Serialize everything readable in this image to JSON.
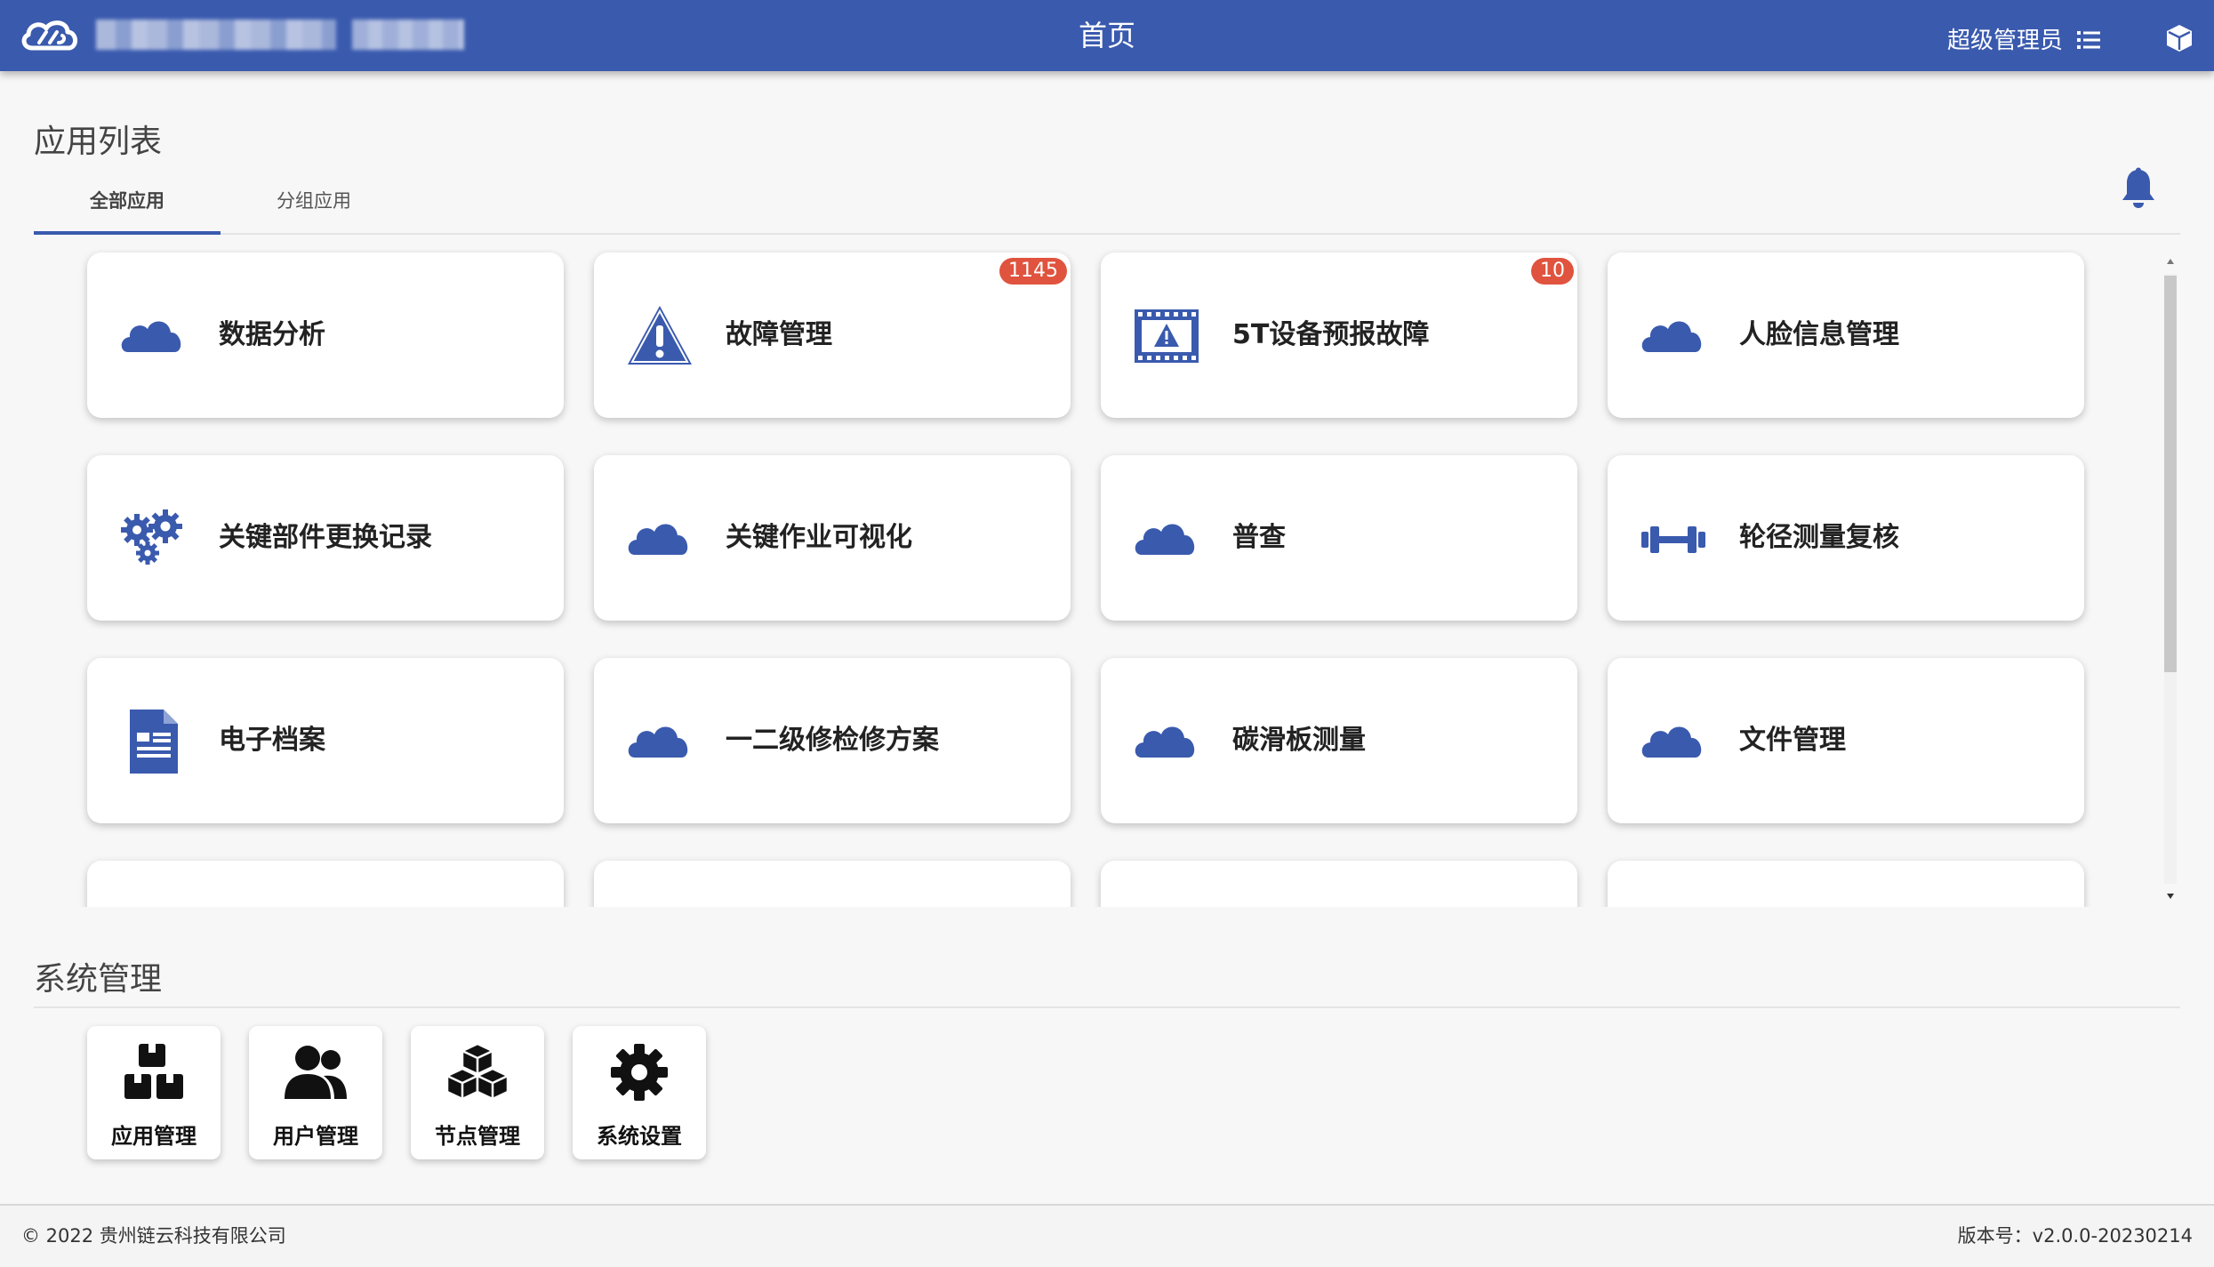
{
  "header": {
    "title": "首页",
    "user": "超级管理员",
    "brand_color": "#3a5aae",
    "logo_icon": "cloud-link-logo",
    "menu_icon": "list-icon",
    "box_icon": "cube-icon"
  },
  "apps": {
    "title": "应用列表",
    "tabs": [
      {
        "label": "全部应用",
        "active": true
      },
      {
        "label": "分组应用",
        "active": false
      }
    ],
    "bell_icon": "bell-icon",
    "items": [
      {
        "label": "数据分析",
        "icon": "cloud-icon",
        "badge": ""
      },
      {
        "label": "故障管理",
        "icon": "warning-triangle-icon",
        "badge": "1145"
      },
      {
        "label": "5T设备预报故障",
        "icon": "film-warning-icon",
        "badge": "10"
      },
      {
        "label": "人脸信息管理",
        "icon": "cloud-icon",
        "badge": ""
      },
      {
        "label": "关键部件更换记录",
        "icon": "gears-icon",
        "badge": ""
      },
      {
        "label": "关键作业可视化",
        "icon": "cloud-icon",
        "badge": ""
      },
      {
        "label": "普查",
        "icon": "cloud-icon",
        "badge": ""
      },
      {
        "label": "轮径测量复核",
        "icon": "dumbbell-icon",
        "badge": ""
      },
      {
        "label": "电子档案",
        "icon": "document-icon",
        "badge": ""
      },
      {
        "label": "一二级修检修方案",
        "icon": "cloud-icon",
        "badge": ""
      },
      {
        "label": "碳滑板测量",
        "icon": "cloud-icon",
        "badge": ""
      },
      {
        "label": "文件管理",
        "icon": "cloud-icon",
        "badge": ""
      }
    ]
  },
  "system": {
    "title": "系统管理",
    "items": [
      {
        "label": "应用管理",
        "icon": "boxes-icon"
      },
      {
        "label": "用户管理",
        "icon": "users-icon"
      },
      {
        "label": "节点管理",
        "icon": "cubes-icon"
      },
      {
        "label": "系统设置",
        "icon": "gear-icon"
      }
    ]
  },
  "footer": {
    "copyright": "© 2022 贵州链云科技有限公司",
    "version": "版本号：v2.0.0-20230214"
  }
}
